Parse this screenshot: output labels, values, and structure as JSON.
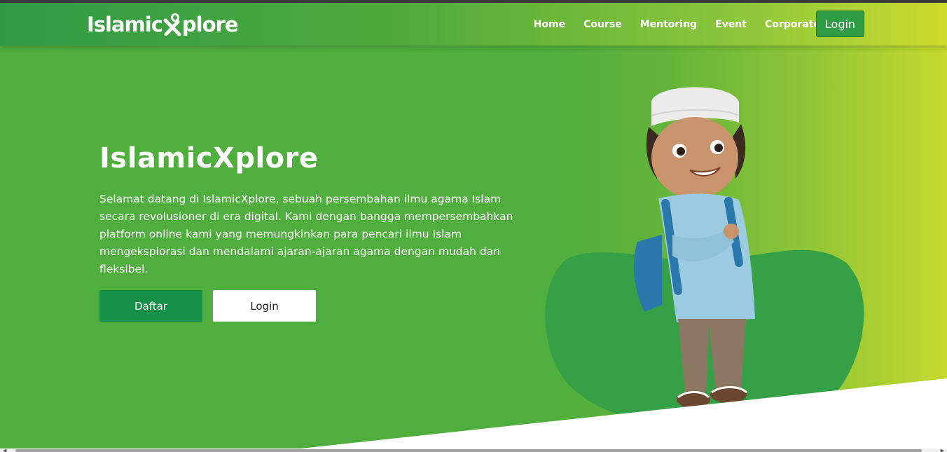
{
  "brand": {
    "logo_left": "Islamic",
    "logo_right": "plore"
  },
  "nav": {
    "links": [
      "Home",
      "Course",
      "Mentoring",
      "Event",
      "Corporate Service"
    ],
    "login_label": "Login"
  },
  "hero": {
    "title": "IslamicXplore",
    "description": "Selamat datang di IslamicXplore, sebuah persembahan ilmu agama Islam secara revolusioner di era digital. Kami dengan bangga mempersembahkan platform online kami yang memungkinkan para pencari ilmu Islam mengeksplorasi dan mendalami ajaran-ajaran agama dengan mudah dan fleksibel.",
    "primary_button": "Daftar",
    "secondary_button": "Login"
  },
  "colors": {
    "brand_green": "#4fae3d",
    "accent_lime": "#cddb2c",
    "primary_button": "#168f48",
    "blob": "#35a045"
  },
  "icons": {
    "logo_mark": "x-person-icon",
    "scroll_left": "triangle-left-icon",
    "scroll_right": "triangle-right-icon"
  }
}
